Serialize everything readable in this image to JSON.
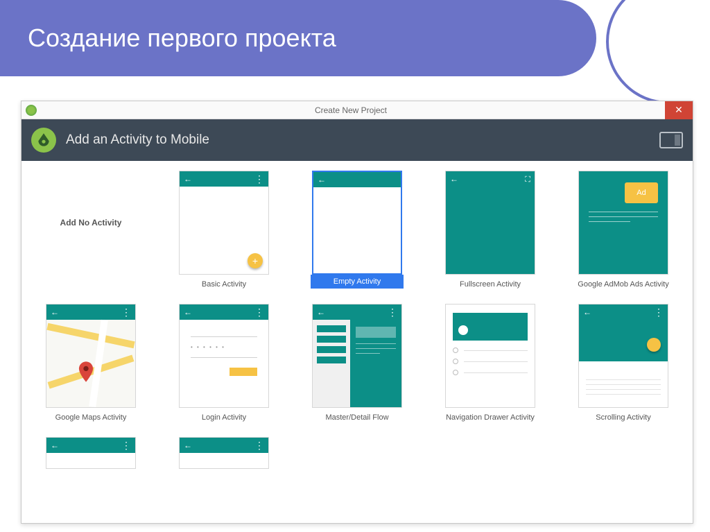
{
  "slide": {
    "title": "Создание первого проекта"
  },
  "window": {
    "title": "Create New Project",
    "header": "Add an Activity to Mobile"
  },
  "templates": {
    "row1": [
      {
        "name": "Add No Activity",
        "type": "none"
      },
      {
        "name": "Basic Activity",
        "type": "basic"
      },
      {
        "name": "Empty Activity",
        "type": "empty",
        "selected": true
      },
      {
        "name": "Fullscreen Activity",
        "type": "fullscreen"
      },
      {
        "name": "Google AdMob Ads Activity",
        "type": "admob"
      }
    ],
    "row2": [
      {
        "name": "Google Maps Activity",
        "type": "maps"
      },
      {
        "name": "Login Activity",
        "type": "login"
      },
      {
        "name": "Master/Detail Flow",
        "type": "master"
      },
      {
        "name": "Navigation Drawer Activity",
        "type": "nav"
      },
      {
        "name": "Scrolling Activity",
        "type": "scroll"
      }
    ]
  },
  "colors": {
    "accent": "#6b73c7",
    "teal": "#0c8f87",
    "amber": "#f6c244"
  },
  "ad_label": "Ad"
}
